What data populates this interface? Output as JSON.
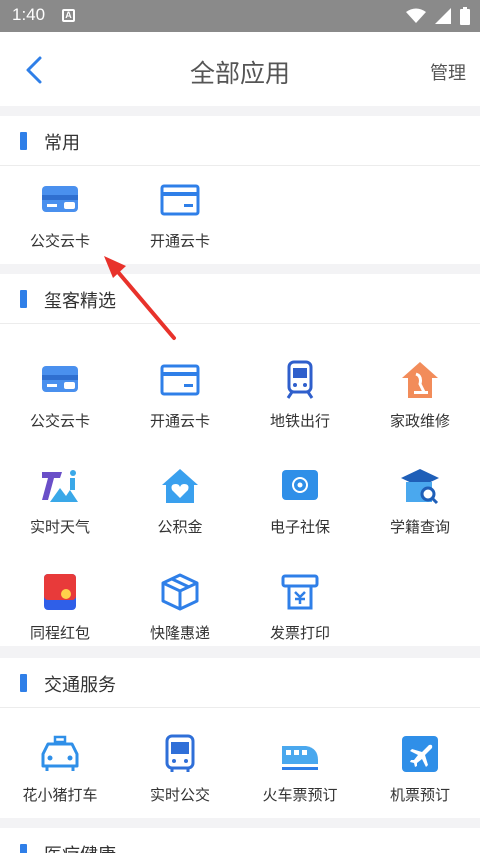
{
  "status_bar": {
    "time": "1:40",
    "notif_letter": "A"
  },
  "nav": {
    "title": "全部应用",
    "manage_label": "管理"
  },
  "sections": [
    {
      "title": "常用",
      "items": [
        {
          "label": "公交云卡"
        },
        {
          "label": "开通云卡"
        }
      ]
    },
    {
      "title": "玺客精选",
      "items": [
        {
          "label": "公交云卡"
        },
        {
          "label": "开通云卡"
        },
        {
          "label": "地铁出行"
        },
        {
          "label": "家政维修"
        },
        {
          "label": "实时天气"
        },
        {
          "label": "公积金"
        },
        {
          "label": "电子社保"
        },
        {
          "label": "学籍查询"
        },
        {
          "label": "同程红包"
        },
        {
          "label": "快隆惠递"
        },
        {
          "label": "发票打印"
        }
      ]
    },
    {
      "title": "交通服务",
      "items": [
        {
          "label": "花小猪打车"
        },
        {
          "label": "实时公交"
        },
        {
          "label": "火车票预订"
        },
        {
          "label": "机票预订"
        }
      ]
    },
    {
      "title": "医疗健康"
    }
  ],
  "colors": {
    "accent": "#2f7fe8",
    "arrow": "#e8322b"
  }
}
